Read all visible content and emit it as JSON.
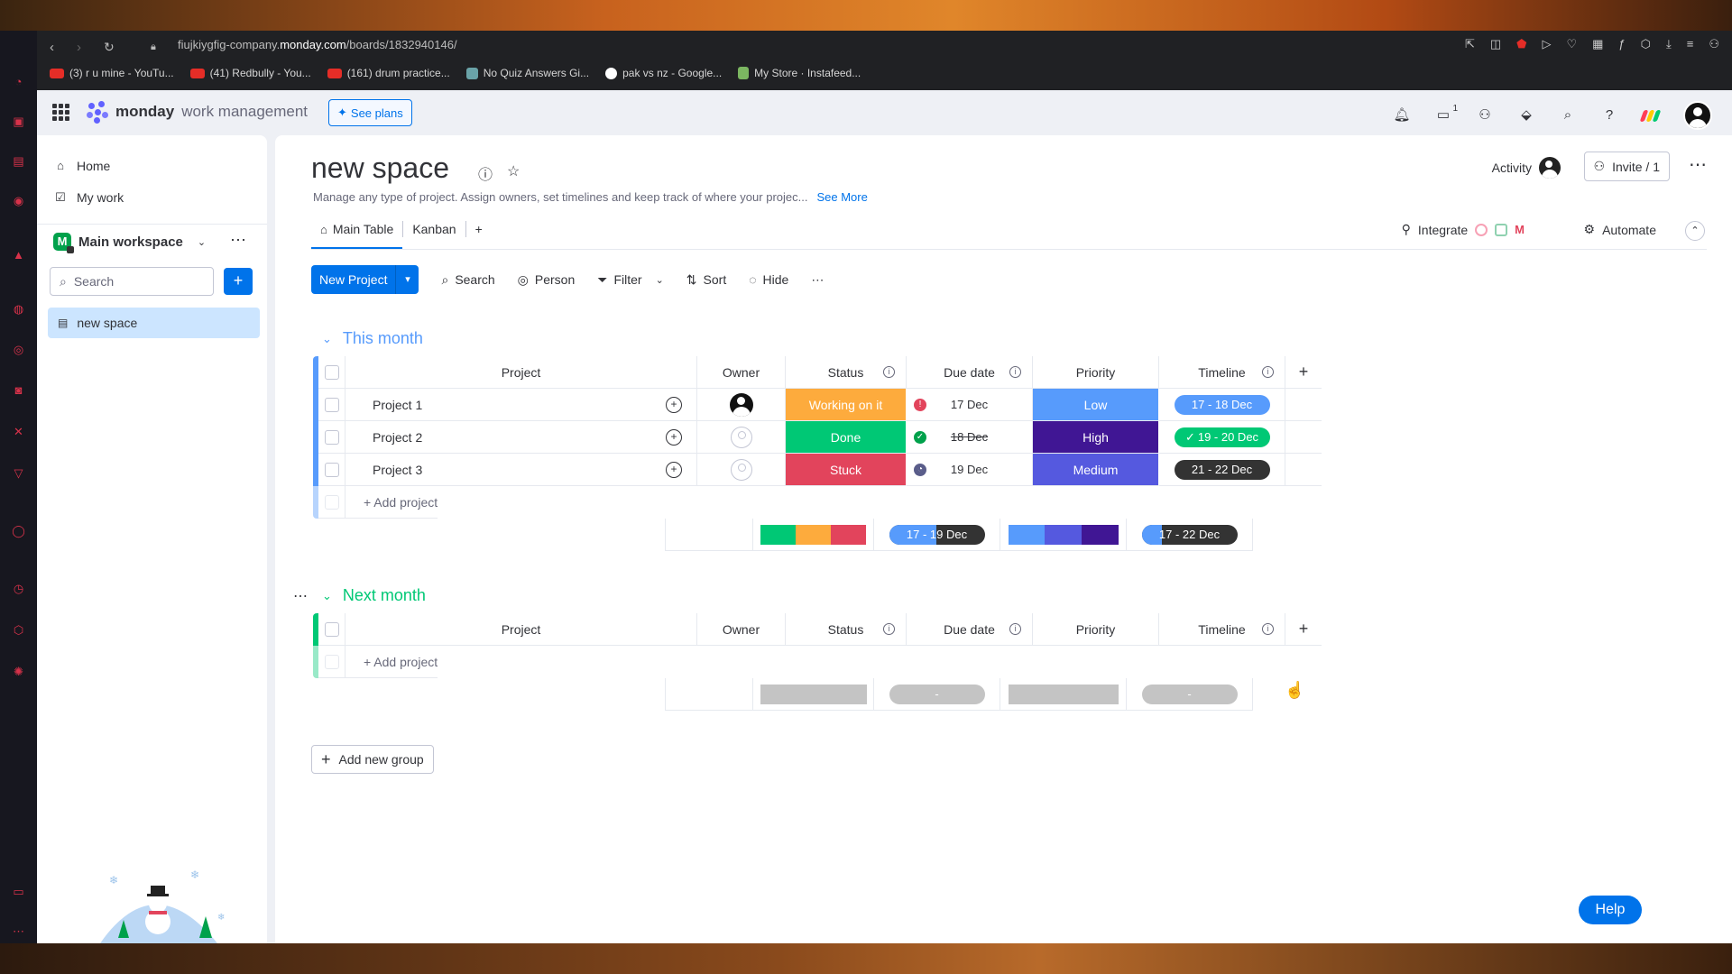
{
  "browser": {
    "url_prefix": "fiujkiygfig-company.",
    "url_domain": "monday.com",
    "url_path": "/boards/1832940146/",
    "bookmarks": [
      {
        "label": "(3) r u mine - YouTu...",
        "icon": "youtube-icon"
      },
      {
        "label": "(41) Redbully - You...",
        "icon": "youtube-icon"
      },
      {
        "label": "(161) drum practice...",
        "icon": "youtube-icon"
      },
      {
        "label": "No Quiz Answers Gi...",
        "icon": "quiz-icon"
      },
      {
        "label": "pak vs nz - Google...",
        "icon": "google-icon"
      },
      {
        "label": "My Store · Instafeed...",
        "icon": "store-icon"
      }
    ]
  },
  "topbar": {
    "brand": "monday",
    "brand_sub": "work management",
    "see_plans": "See plans",
    "inbox_badge": "1"
  },
  "sidebar": {
    "home": "Home",
    "my_work": "My work",
    "workspace_initial": "M",
    "workspace": "Main workspace",
    "search_placeholder": "Search",
    "board": "new space"
  },
  "board": {
    "title": "new space",
    "description": "Manage any type of project. Assign owners, set timelines and keep track of where your projec...",
    "see_more": "See More",
    "activity": "Activity",
    "invite": "Invite / 1",
    "tabs": [
      "Main Table",
      "Kanban"
    ],
    "integrate": "Integrate",
    "automate": "Automate"
  },
  "toolbar": {
    "new_project": "New Project",
    "search": "Search",
    "person": "Person",
    "filter": "Filter",
    "sort": "Sort",
    "hide": "Hide"
  },
  "columns": {
    "project": "Project",
    "owner": "Owner",
    "status": "Status",
    "due_date": "Due date",
    "priority": "Priority",
    "timeline": "Timeline"
  },
  "colors": {
    "this_month": "#579bfc",
    "next_month": "#00c875",
    "working": "#fdab3d",
    "done": "#00c875",
    "stuck": "#e2445c",
    "low": "#579bfc",
    "high": "#401694",
    "medium": "#5559df",
    "timeline_blue": "#579bfc",
    "timeline_green": "#00c875",
    "timeline_dark": "#333333",
    "empty": "#c4c4c4"
  },
  "groups": [
    {
      "name": "This month",
      "rows": [
        {
          "project": "Project 1",
          "status": "Working on it",
          "due": "17 Dec",
          "priority": "Low",
          "timeline": "17 - 18 Dec"
        },
        {
          "project": "Project 2",
          "status": "Done",
          "due": "18 Dec",
          "priority": "High",
          "timeline": "19 - 20 Dec"
        },
        {
          "project": "Project 3",
          "status": "Stuck",
          "due": "19 Dec",
          "priority": "Medium",
          "timeline": "21 - 22 Dec"
        }
      ],
      "add": "+ Add project",
      "summary": {
        "due": "17 - 19 Dec",
        "timeline": "17 - 22 Dec"
      }
    },
    {
      "name": "Next month",
      "rows": [],
      "add": "+ Add project",
      "summary": {
        "due": "-",
        "timeline": "-"
      }
    }
  ],
  "add_group": "Add new group",
  "help": "Help"
}
